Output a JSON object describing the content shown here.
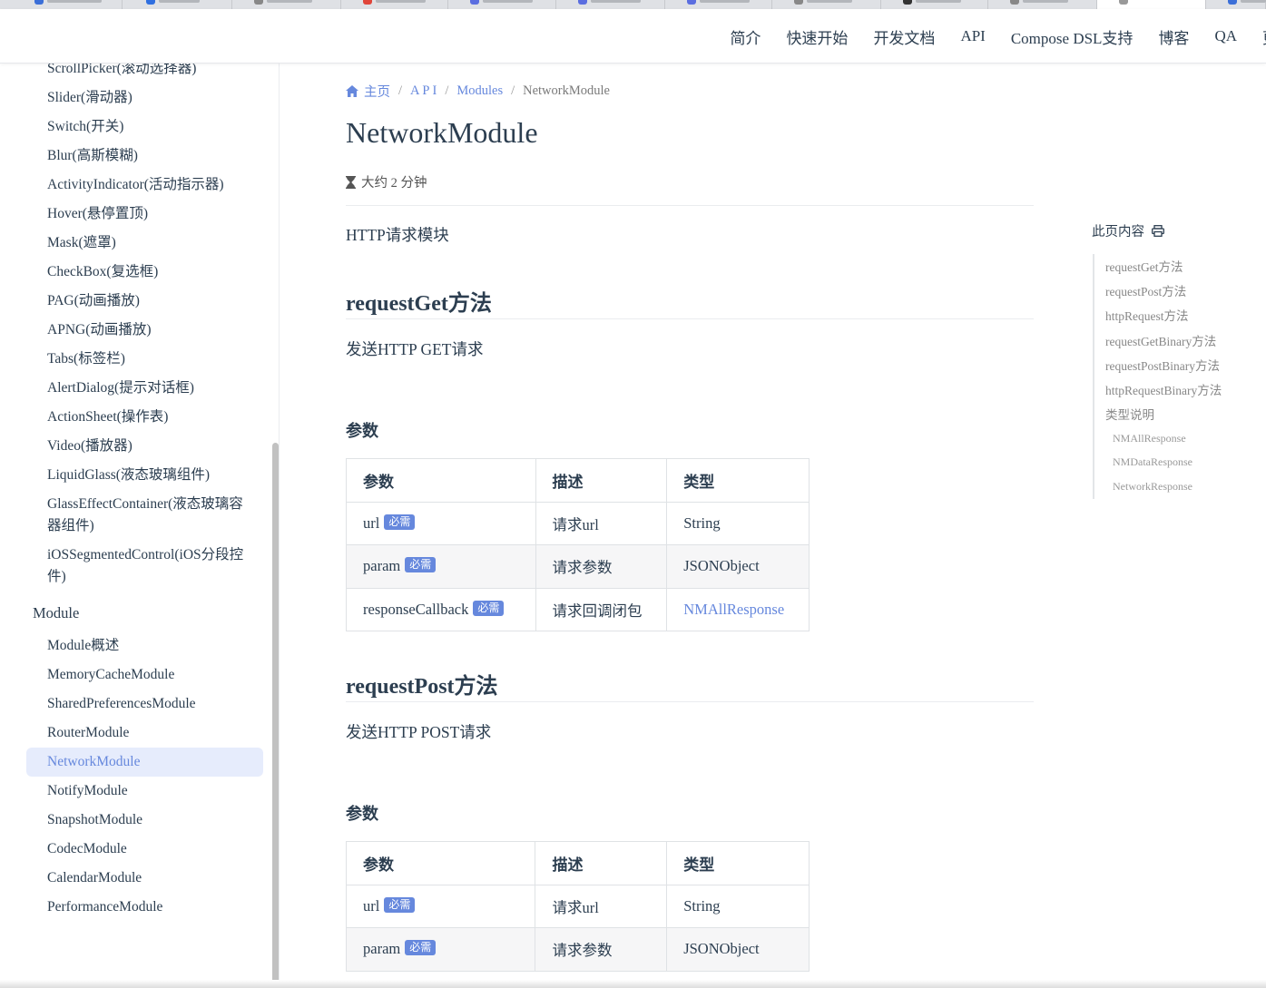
{
  "nav": {
    "links": [
      "简介",
      "快速开始",
      "开发文档",
      "API",
      "Compose DSL支持",
      "博客",
      "QA",
      "更新"
    ]
  },
  "sidebar": {
    "items_top": [
      "ScrollPicker(滚动选择器)",
      "Slider(滑动器)",
      "Switch(开关)",
      "Blur(高斯模糊)",
      "ActivityIndicator(活动指示器)",
      "Hover(悬停置顶)",
      "Mask(遮罩)",
      "CheckBox(复选框)",
      "PAG(动画播放)",
      "APNG(动画播放)",
      "Tabs(标签栏)",
      "AlertDialog(提示对话框)",
      "ActionSheet(操作表)",
      "Video(播放器)",
      "LiquidGlass(液态玻璃组件)"
    ],
    "item_glass_1": "GlassEffectContainer(液态玻璃容",
    "item_glass_2": "器组件)",
    "item_ios_1": "iOSSegmentedControl(iOS分段控",
    "item_ios_2": "件)",
    "group_module": "Module",
    "module_items": [
      "Module概述",
      "MemoryCacheModule",
      "SharedPreferencesModule",
      "RouterModule",
      "NetworkModule",
      "NotifyModule",
      "SnapshotModule",
      "CodecModule",
      "CalendarModule",
      "PerformanceModule"
    ],
    "active_item": "NetworkModule"
  },
  "breadcrumb": {
    "home": "主页",
    "api": "A P I",
    "modules": "Modules",
    "current": "NetworkModule"
  },
  "page": {
    "title": "NetworkModule",
    "read_time": "大约 2 分钟",
    "intro": "HTTP请求模块"
  },
  "sections": [
    {
      "heading": "requestGet方法",
      "desc": "发送HTTP GET请求",
      "params_heading": "参数",
      "table": {
        "headers": [
          "参数",
          "描述",
          "类型"
        ],
        "rows": [
          {
            "name": "url",
            "badge": "必需",
            "desc": "请求url",
            "type": "String"
          },
          {
            "name": "param",
            "badge": "必需",
            "desc": "请求参数",
            "type": "JSONObject"
          },
          {
            "name": "responseCallback",
            "badge": "必需",
            "desc": "请求回调闭包",
            "type": "NMAllResponse"
          }
        ]
      }
    },
    {
      "heading": "requestPost方法",
      "desc": "发送HTTP POST请求",
      "params_heading": "参数",
      "table": {
        "headers": [
          "参数",
          "描述",
          "类型"
        ],
        "rows": [
          {
            "name": "url",
            "badge": "必需",
            "desc": "请求url",
            "type": "String"
          },
          {
            "name": "param",
            "badge": "必需",
            "desc": "请求参数",
            "type": "JSONObject"
          }
        ]
      }
    }
  ],
  "toc": {
    "title": "此页内容",
    "items": [
      "requestGet方法",
      "requestPost方法",
      "httpRequest方法",
      "requestGetBinary方法",
      "requestPostBinary方法",
      "httpRequestBinary方法",
      "类型说明"
    ],
    "sub_items": [
      "NMAllResponse",
      "NMDataResponse",
      "NetworkResponse"
    ]
  },
  "colors": {
    "accent": "#6688dd",
    "active_bg": "#e6ecfc",
    "text": "#2c3e50"
  }
}
